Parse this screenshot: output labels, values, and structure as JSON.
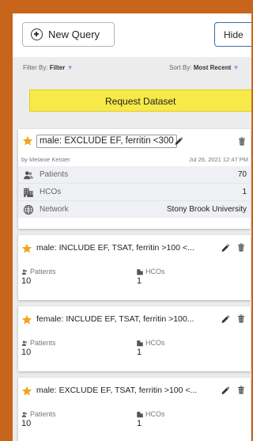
{
  "toolbar": {
    "new_query_label": "New Query",
    "hide_label": "Hide"
  },
  "filter": {
    "label": "Filter By:",
    "value": "Filter"
  },
  "sort": {
    "label": "Sort By:",
    "value": "Most Recent"
  },
  "request_label": "Request Dataset",
  "queries": [
    {
      "title": "male: EXCLUDE EF, ferritin <300",
      "author": "by Melanie Keister",
      "date": "Jul 26, 2021 12:47 PM",
      "stats": [
        {
          "label": "Patients",
          "value": "70",
          "icon": "patients-icon"
        },
        {
          "label": "HCOs",
          "value": "1",
          "icon": "hco-building-icon"
        },
        {
          "label": "Network",
          "value": "Stony Brook University",
          "icon": "globe-icon"
        }
      ]
    },
    {
      "title": "male: INCLUDE EF, TSAT, ferritin >100 <...",
      "patients_label": "Patients",
      "patients": "10",
      "hcos_label": "HCOs",
      "hcos": "1"
    },
    {
      "title": "female: INCLUDE EF, TSAT, ferritin >100...",
      "patients_label": "Patients",
      "patients": "10",
      "hcos_label": "HCOs",
      "hcos": "1"
    },
    {
      "title": "male: EXCLUDE EF, TSAT, ferritin >100 <...",
      "patients_label": "Patients",
      "patients": "10",
      "hcos_label": "HCOs",
      "hcos": "1"
    }
  ],
  "colors": {
    "frame": "#c8651b",
    "star": "#f4a41c",
    "request_bg": "#f7e948",
    "hide_border": "#3b6ea8"
  }
}
